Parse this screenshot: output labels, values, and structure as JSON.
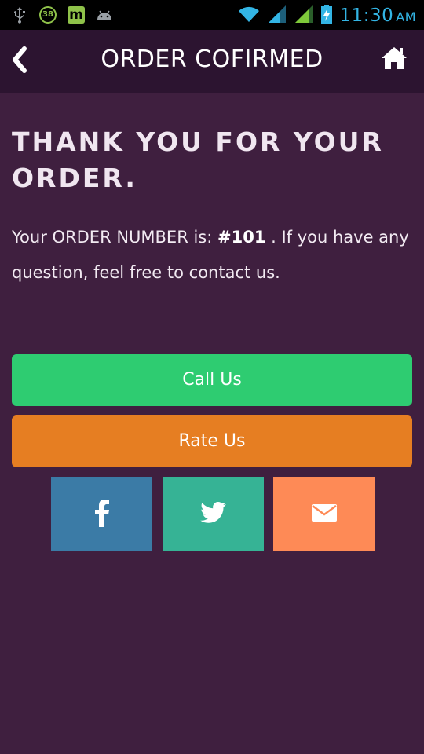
{
  "status_bar": {
    "icons_left": [
      "usb-icon",
      "notification-badge",
      "app-m-icon",
      "android-icon"
    ],
    "badge_count": "38",
    "app_letter": "m",
    "time": "11:30",
    "ampm": "AM",
    "icons_right": [
      "wifi-icon",
      "signal-icon",
      "signal-icon-2",
      "battery-charging-icon"
    ],
    "color": "#33b5e5"
  },
  "header": {
    "title": "ORDER COFIRMED",
    "back_icon": "chevron-left-icon",
    "home_icon": "home-icon",
    "background": "#2c1430"
  },
  "main": {
    "headline": "THANK YOU FOR YOUR ORDER.",
    "message_prefix": "Your ORDER NUMBER is: ",
    "order_number": "#101",
    "message_suffix": " . If you have any question, feel free to contact us.",
    "background": "#3f1f3f"
  },
  "actions": {
    "call_label": "Call Us",
    "call_color": "#2ecc71",
    "rate_label": "Rate Us",
    "rate_color": "#e67e22"
  },
  "social": [
    {
      "name": "facebook",
      "icon": "facebook-icon",
      "color": "#3b7ba6"
    },
    {
      "name": "twitter",
      "icon": "twitter-icon",
      "color": "#36b395"
    },
    {
      "name": "email",
      "icon": "mail-icon",
      "color": "#fe8a56"
    }
  ]
}
